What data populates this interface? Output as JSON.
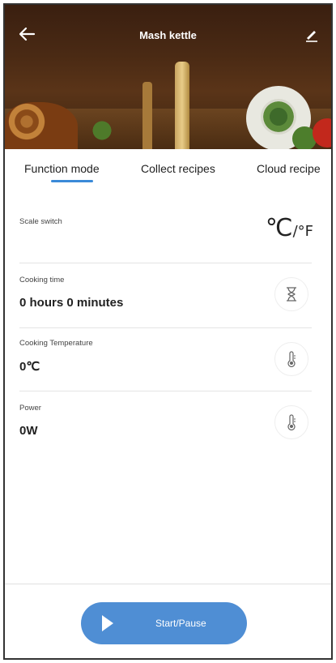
{
  "header": {
    "title": "Mash kettle"
  },
  "tabs": [
    {
      "label": "Function mode",
      "active": true
    },
    {
      "label": "Collect recipes",
      "active": false
    },
    {
      "label": "Cloud recipe",
      "active": false
    }
  ],
  "scale_switch": {
    "label": "Scale switch",
    "celsius": "℃",
    "fahrenheit": "/°F"
  },
  "cooking_time": {
    "label": "Cooking time",
    "value": "0 hours 0 minutes",
    "icon": "hourglass-icon"
  },
  "cooking_temperature": {
    "label": "Cooking Temperature",
    "value": "0℃",
    "icon": "thermometer-icon"
  },
  "power": {
    "label": "Power",
    "value": "0W",
    "icon": "thermometer-icon"
  },
  "start_button": {
    "label": "Start/Pause"
  },
  "colors": {
    "accent": "#4f8ed4",
    "tab_underline": "#3a8ad8"
  }
}
